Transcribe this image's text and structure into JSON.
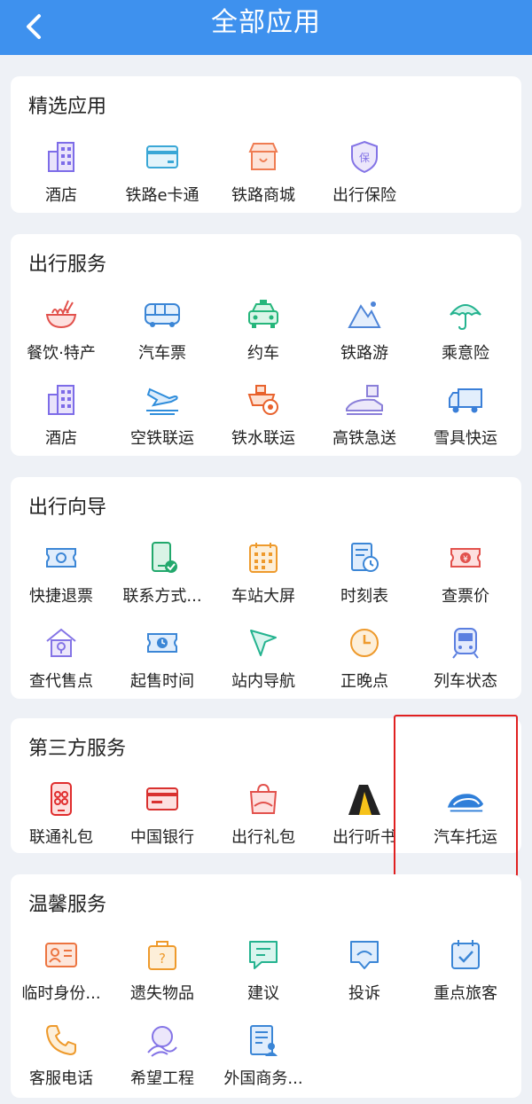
{
  "header": {
    "title": "全部应用",
    "back_icon": "chevron-left-icon"
  },
  "sections": [
    {
      "title": "精选应用",
      "items": [
        {
          "label": "酒店",
          "icon": "hotel-building-icon"
        },
        {
          "label": "铁路e卡通",
          "icon": "card-icon"
        },
        {
          "label": "铁路商城",
          "icon": "shop-icon"
        },
        {
          "label": "出行保险",
          "icon": "insurance-shield-icon"
        }
      ]
    },
    {
      "title": "出行服务",
      "items": [
        {
          "label": "餐饮·特产",
          "icon": "noodle-bowl-icon"
        },
        {
          "label": "汽车票",
          "icon": "bus-icon"
        },
        {
          "label": "约车",
          "icon": "taxi-icon"
        },
        {
          "label": "铁路游",
          "icon": "mountain-icon"
        },
        {
          "label": "乘意险",
          "icon": "umbrella-icon"
        },
        {
          "label": "酒店",
          "icon": "hotel-building-icon"
        },
        {
          "label": "空铁联运",
          "icon": "plane-train-icon"
        },
        {
          "label": "铁水联运",
          "icon": "ship-train-icon"
        },
        {
          "label": "高铁急送",
          "icon": "bullet-train-package-icon"
        },
        {
          "label": "雪具快运",
          "icon": "truck-icon"
        }
      ]
    },
    {
      "title": "出行向导",
      "items": [
        {
          "label": "快捷退票",
          "icon": "ticket-refund-icon"
        },
        {
          "label": "联系方式...",
          "icon": "phone-check-icon"
        },
        {
          "label": "车站大屏",
          "icon": "calendar-grid-icon"
        },
        {
          "label": "时刻表",
          "icon": "timetable-icon"
        },
        {
          "label": "查票价",
          "icon": "ticket-yen-icon"
        },
        {
          "label": "查代售点",
          "icon": "house-location-icon"
        },
        {
          "label": "起售时间",
          "icon": "ticket-clock-icon"
        },
        {
          "label": "站内导航",
          "icon": "navigation-arrow-icon"
        },
        {
          "label": "正晚点",
          "icon": "clock-icon"
        },
        {
          "label": "列车状态",
          "icon": "train-front-icon"
        }
      ]
    },
    {
      "title": "第三方服务",
      "items": [
        {
          "label": "联通礼包",
          "icon": "phone-unicom-icon"
        },
        {
          "label": "中国银行",
          "icon": "bank-card-icon"
        },
        {
          "label": "出行礼包",
          "icon": "gift-bag-icon"
        },
        {
          "label": "出行听书",
          "icon": "audiobook-tent-icon"
        },
        {
          "label": "汽车托运",
          "icon": "car-shipping-icon"
        }
      ]
    },
    {
      "title": "温馨服务",
      "items": [
        {
          "label": "临时身份...",
          "icon": "id-card-icon"
        },
        {
          "label": "遗失物品",
          "icon": "lost-luggage-icon"
        },
        {
          "label": "建议",
          "icon": "suggestion-message-icon"
        },
        {
          "label": "投诉",
          "icon": "complaint-message-icon"
        },
        {
          "label": "重点旅客",
          "icon": "calendar-check-icon"
        },
        {
          "label": "客服电话",
          "icon": "phone-icon"
        },
        {
          "label": "希望工程",
          "icon": "hope-project-icon"
        },
        {
          "label": "外国商务...",
          "icon": "business-document-icon"
        }
      ]
    }
  ]
}
